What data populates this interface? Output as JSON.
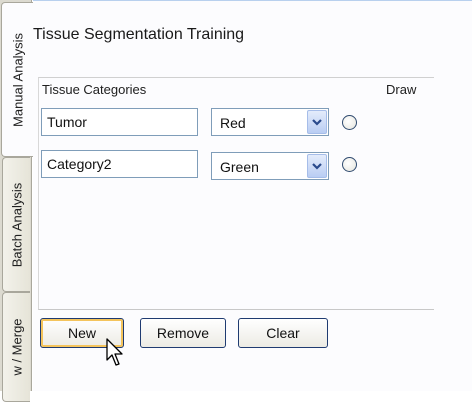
{
  "tabs": [
    {
      "label": "Manual Analysis",
      "active": true
    },
    {
      "label": "Batch Analysis",
      "active": false
    },
    {
      "label": "w / Merge",
      "active": false
    }
  ],
  "panel": {
    "title": "Tissue Segmentation Training",
    "columns": {
      "categories": "Tissue Categories",
      "draw": "Draw"
    },
    "rows": [
      {
        "name": "Tumor",
        "color": "Red",
        "draw_selected": false
      },
      {
        "name": "Category2",
        "color": "Green",
        "draw_selected": false
      }
    ]
  },
  "buttons": {
    "new": "New",
    "remove": "Remove",
    "clear": "Clear"
  },
  "colors": {
    "accent_focus": "#f4c45c",
    "button_border": "#1f3b71",
    "combo_button": "#b9cdf3"
  }
}
